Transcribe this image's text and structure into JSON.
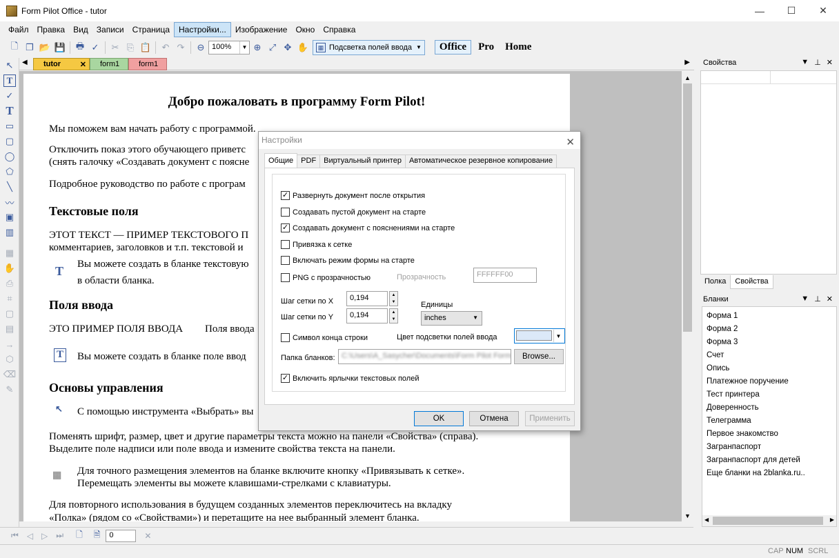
{
  "window": {
    "title": "Form Pilot Office - tutor",
    "minimize": "—",
    "maximize": "☐",
    "close": "✕"
  },
  "menu": [
    "Файл",
    "Правка",
    "Вид",
    "Записи",
    "Страница",
    "Настройки...",
    "Изображение",
    "Окно",
    "Справка"
  ],
  "toolbar": {
    "zoom": "100%",
    "highlight_label": "Подсветка полей ввода",
    "modes": [
      "Office",
      "Pro",
      "Home"
    ]
  },
  "doc_tabs": [
    "tutor",
    "form1",
    "form1"
  ],
  "document": {
    "title": "Добро пожаловать в программу Form Pilot!",
    "p1": "Мы поможем вам начать работу с программой.",
    "p2a": "Отключить показ этого обучающего приветс",
    "p2b": "(снять галочку «Создавать документ с поясне",
    "p3": "Подробное руководство по работе с програм",
    "h1": "Текстовые поля",
    "p4a": "ЭТОТ ТЕКСТ — ПРИМЕР ТЕКСТОВОГО П",
    "p4b": "комментариев, заголовков и т.п. текстовой и",
    "p5a": "Вы можете создать в бланке текстовую",
    "p5b": "в области бланка.",
    "h2": "Поля ввода",
    "p6a": "ЭТО ПРИМЕР ПОЛЯ ВВОДА",
    "p6b": "Поля ввода",
    "p7": "Вы можете создать в бланке поле ввод",
    "h3": "Основы управления",
    "p8": "С помощью инструмента «Выбрать» вы",
    "p9a": "Поменять шрифт, размер, цвет и другие параметры текста можно на панели «Свойства» (справа).",
    "p9b": "Выделите поле надписи или поле ввода и измените свойства текста на панели.",
    "p10a": "Для точного размещения элементов на бланке включите кнопку «Привязывать к сетке».",
    "p10b": "Перемещать элементы вы можете клавишами-стрелками с клавиатуры.",
    "p11a": "Для повторного использования в будущем созданных элементов переключитесь на вкладку",
    "p11b": "«Полка» (рядом со «Свойствами») и перетащите на нее выбранный элемент бланка."
  },
  "page_nav": {
    "page": "0"
  },
  "properties_panel": {
    "title": "Свойства",
    "tabs": [
      "Полка",
      "Свойства"
    ]
  },
  "blanks_panel": {
    "title": "Бланки",
    "items": [
      "Форма 1",
      "Форма 2",
      "Форма 3",
      "Счет",
      "Опись",
      "Платежное поручение",
      "Тест принтера",
      "Доверенность",
      "Телеграмма",
      "Первое знакомство",
      "Загранпаспорт",
      "Загранпаспорт для детей",
      "Еще бланки на 2blanka.ru.."
    ]
  },
  "dialog": {
    "title": "Настройки",
    "tabs": [
      "Общие",
      "PDF",
      "Виртуальный принтер",
      "Автоматическое резервное копирование"
    ],
    "cb_expand": "Развернуть документ после открытия",
    "cb_empty": "Создавать пустой документ на старте",
    "cb_tutorial": "Создавать документ с пояснениями на старте",
    "cb_grid": "Привязка к сетке",
    "cb_form_mode": "Включать режим формы на старте",
    "cb_png": "PNG с прозрачностью",
    "transparency_label": "Прозрачность",
    "transparency_value": "FFFFFF00",
    "grid_x_label": "Шаг сетки по X",
    "grid_x_value": "0,194",
    "grid_y_label": "Шаг сетки по Y",
    "grid_y_value": "0,194",
    "units_label": "Единицы",
    "units_value": "inches",
    "cb_eol": "Символ конца строки",
    "highlight_color_label": "Цвет подсветки полей ввода",
    "highlight_color": "#dce9f8",
    "folder_label": "Папка бланков:",
    "folder_value": "C:\\Users\\A_Sasycher\\Documents\\Form Pilot Forms",
    "browse": "Browse...",
    "cb_labels": "Включить ярлычки текстовых полей",
    "ok": "OK",
    "cancel": "Отмена",
    "apply": "Применить",
    "checked": {
      "expand": true,
      "empty": false,
      "tutorial": true,
      "grid": false,
      "form_mode": false,
      "png": false,
      "eol": false,
      "labels": true
    }
  },
  "status": {
    "cap": "CAP",
    "num": "NUM",
    "scrl": "SCRL"
  }
}
